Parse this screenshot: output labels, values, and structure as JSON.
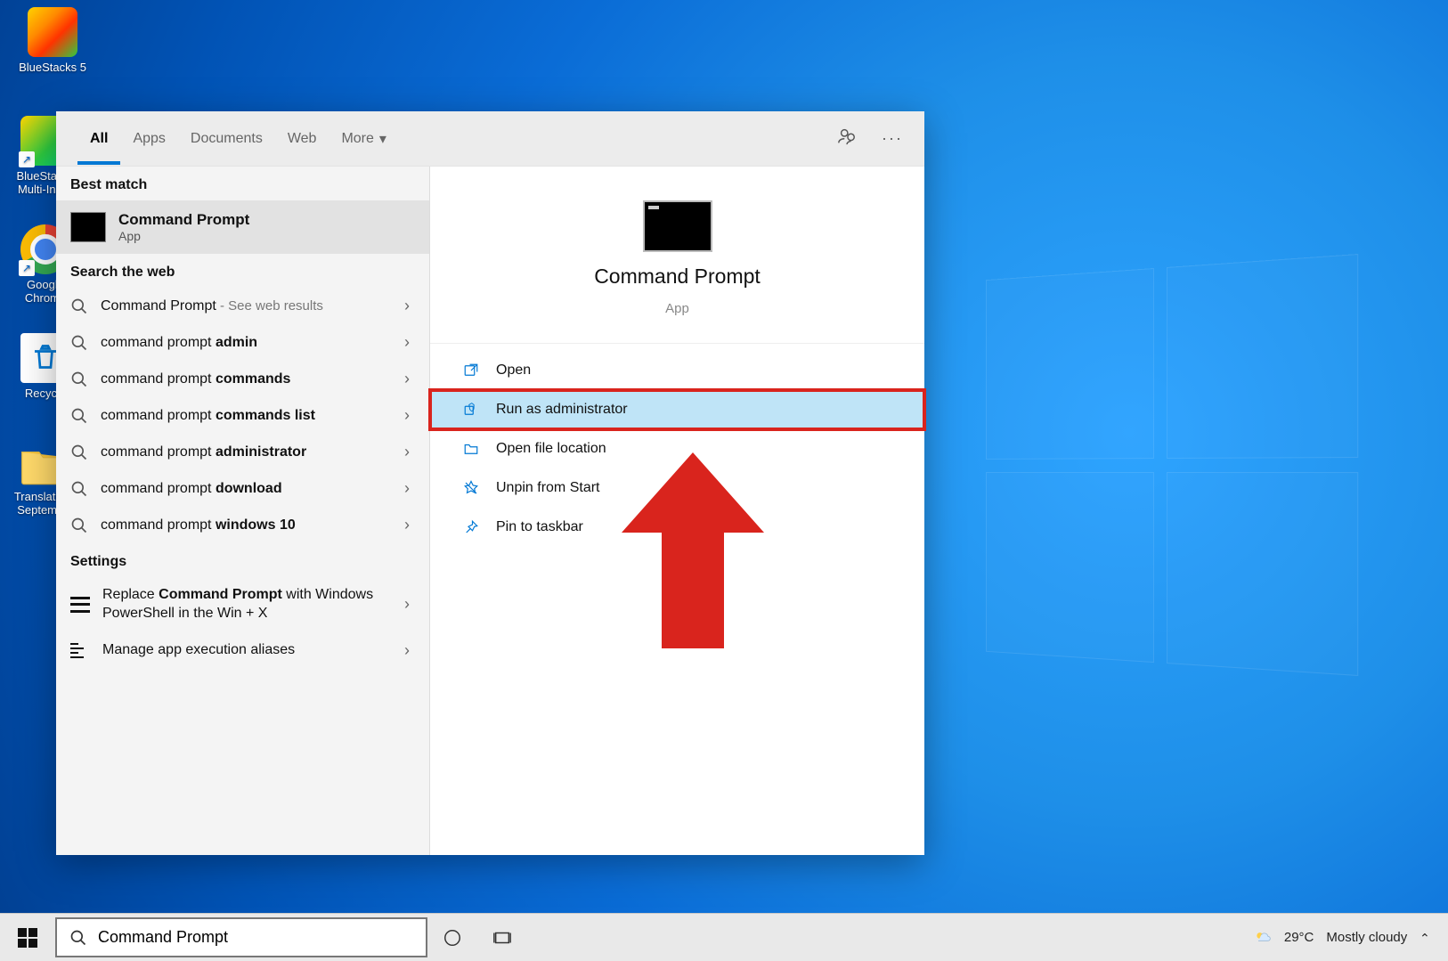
{
  "desktop": {
    "icons": [
      {
        "label": "BlueStacks 5"
      },
      {
        "label": "BlueStacks Multi-Ins…"
      },
      {
        "label": "Google Chrome"
      },
      {
        "label": "Recycle"
      },
      {
        "label": "Translations September"
      }
    ]
  },
  "search_panel": {
    "tabs": [
      "All",
      "Apps",
      "Documents",
      "Web",
      "More"
    ],
    "best_match_label": "Best match",
    "best_match": {
      "title": "Command Prompt",
      "subtitle": "App"
    },
    "search_web_label": "Search the web",
    "web_results": [
      {
        "prefix": "Command Prompt",
        "suffix": " - See web results"
      },
      {
        "prefix": "command prompt ",
        "bold": "admin"
      },
      {
        "prefix": "command prompt ",
        "bold": "commands"
      },
      {
        "prefix": "command prompt ",
        "bold": "commands list"
      },
      {
        "prefix": "command prompt ",
        "bold": "administrator"
      },
      {
        "prefix": "command prompt ",
        "bold": "download"
      },
      {
        "prefix": "command prompt ",
        "bold": "windows 10"
      }
    ],
    "settings_label": "Settings",
    "settings_items": [
      {
        "line1": "Replace ",
        "bold": "Command Prompt",
        "line2": " with Windows PowerShell in the Win + X"
      },
      {
        "line1": "Manage app execution aliases"
      }
    ],
    "detail": {
      "title": "Command Prompt",
      "subtitle": "App",
      "actions": [
        {
          "label": "Open",
          "icon": "open"
        },
        {
          "label": "Run as administrator",
          "icon": "admin",
          "highlight": true
        },
        {
          "label": "Open file location",
          "icon": "folder"
        },
        {
          "label": "Unpin from Start",
          "icon": "unpin"
        },
        {
          "label": "Pin to taskbar",
          "icon": "pin"
        }
      ]
    }
  },
  "taskbar": {
    "search_value": "Command Prompt",
    "weather": {
      "temp": "29°C",
      "desc": "Mostly cloudy"
    }
  }
}
